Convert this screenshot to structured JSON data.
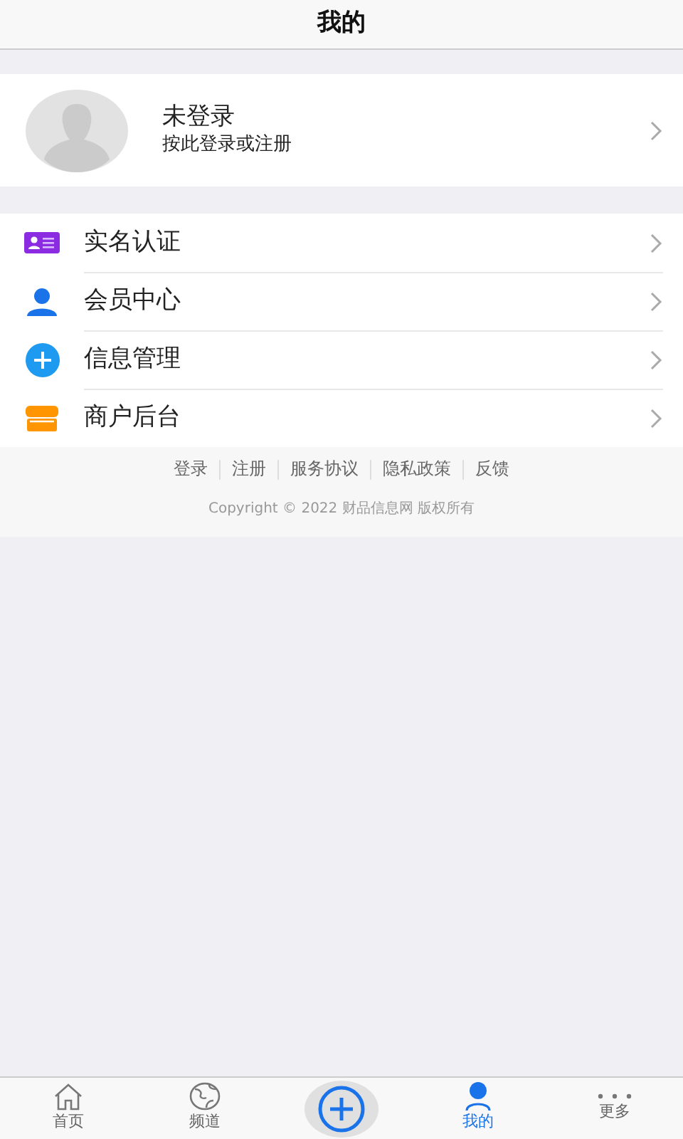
{
  "header": {
    "title": "我的"
  },
  "profile": {
    "name": "未登录",
    "hint": "按此登录或注册"
  },
  "menu": [
    {
      "kind": "idcard",
      "label": "实名认证"
    },
    {
      "kind": "user",
      "label": "会员中心"
    },
    {
      "kind": "plus",
      "label": "信息管理"
    },
    {
      "kind": "shop",
      "label": "商户后台"
    }
  ],
  "footer": {
    "links": [
      "登录",
      "注册",
      "服务协议",
      "隐私政策",
      "反馈"
    ],
    "copyright": "Copyright © 2022 财品信息网 版权所有"
  },
  "tabbar": [
    {
      "kind": "home",
      "label": "首页",
      "selected": false
    },
    {
      "kind": "globe",
      "label": "频道",
      "selected": false
    },
    {
      "kind": "add",
      "selected": false
    },
    {
      "kind": "user",
      "label": "我的",
      "selected": true
    },
    {
      "kind": "more",
      "label": "更多",
      "selected": false
    }
  ]
}
